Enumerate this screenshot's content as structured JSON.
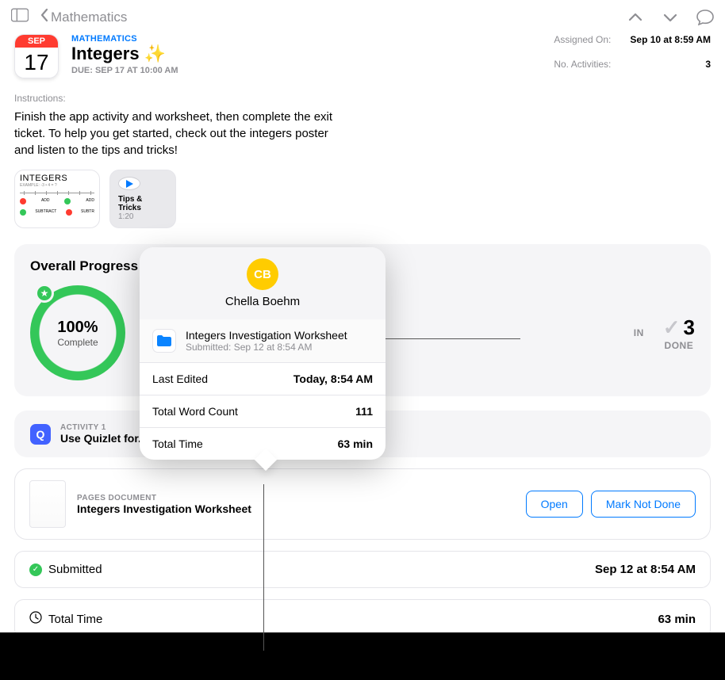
{
  "nav": {
    "back_label": "Mathematics"
  },
  "header": {
    "month": "SEP",
    "day": "17",
    "subject": "MATHEMATICS",
    "title": "Integers",
    "due": "DUE: SEP 17 AT 10:00 AM",
    "assigned_label": "Assigned On:",
    "assigned_value": "Sep 10 at 8:59 AM",
    "activities_label": "No. Activities:",
    "activities_value": "3"
  },
  "instructions": {
    "label": "Instructions:",
    "text": "Finish the app activity and worksheet, then complete the exit ticket. To help you get started, check out the integers poster and listen to the tips and tricks!"
  },
  "attachments": {
    "poster_title": "INTEGERS",
    "media_title": "Tips & Tricks",
    "media_duration": "1:20"
  },
  "progress": {
    "heading": "Overall Progress",
    "percent": "100%",
    "complete_label": "Complete",
    "stat_in_value": "IN",
    "stat_done_value": "3",
    "stat_done_label": "DONE"
  },
  "activity1": {
    "tag": "ACTIVITY 1",
    "title": "Use Quizlet for..."
  },
  "doc": {
    "tag": "PAGES DOCUMENT",
    "title": "Integers Investigation Worksheet",
    "open": "Open",
    "mark": "Mark Not Done"
  },
  "rows": {
    "submitted_label": "Submitted",
    "submitted_value": "Sep 12 at 8:54 AM",
    "totaltime_label": "Total Time",
    "totaltime_value": "63 min"
  },
  "popover": {
    "initials": "CB",
    "name": "Chella Boehm",
    "doc_title": "Integers Investigation Worksheet",
    "doc_sub": "Submitted: Sep 12 at 8:54 AM",
    "last_edited_label": "Last Edited",
    "last_edited_value": "Today, 8:54 AM",
    "word_count_label": "Total Word Count",
    "word_count_value": "111",
    "total_time_label": "Total Time",
    "total_time_value": "63 min"
  }
}
